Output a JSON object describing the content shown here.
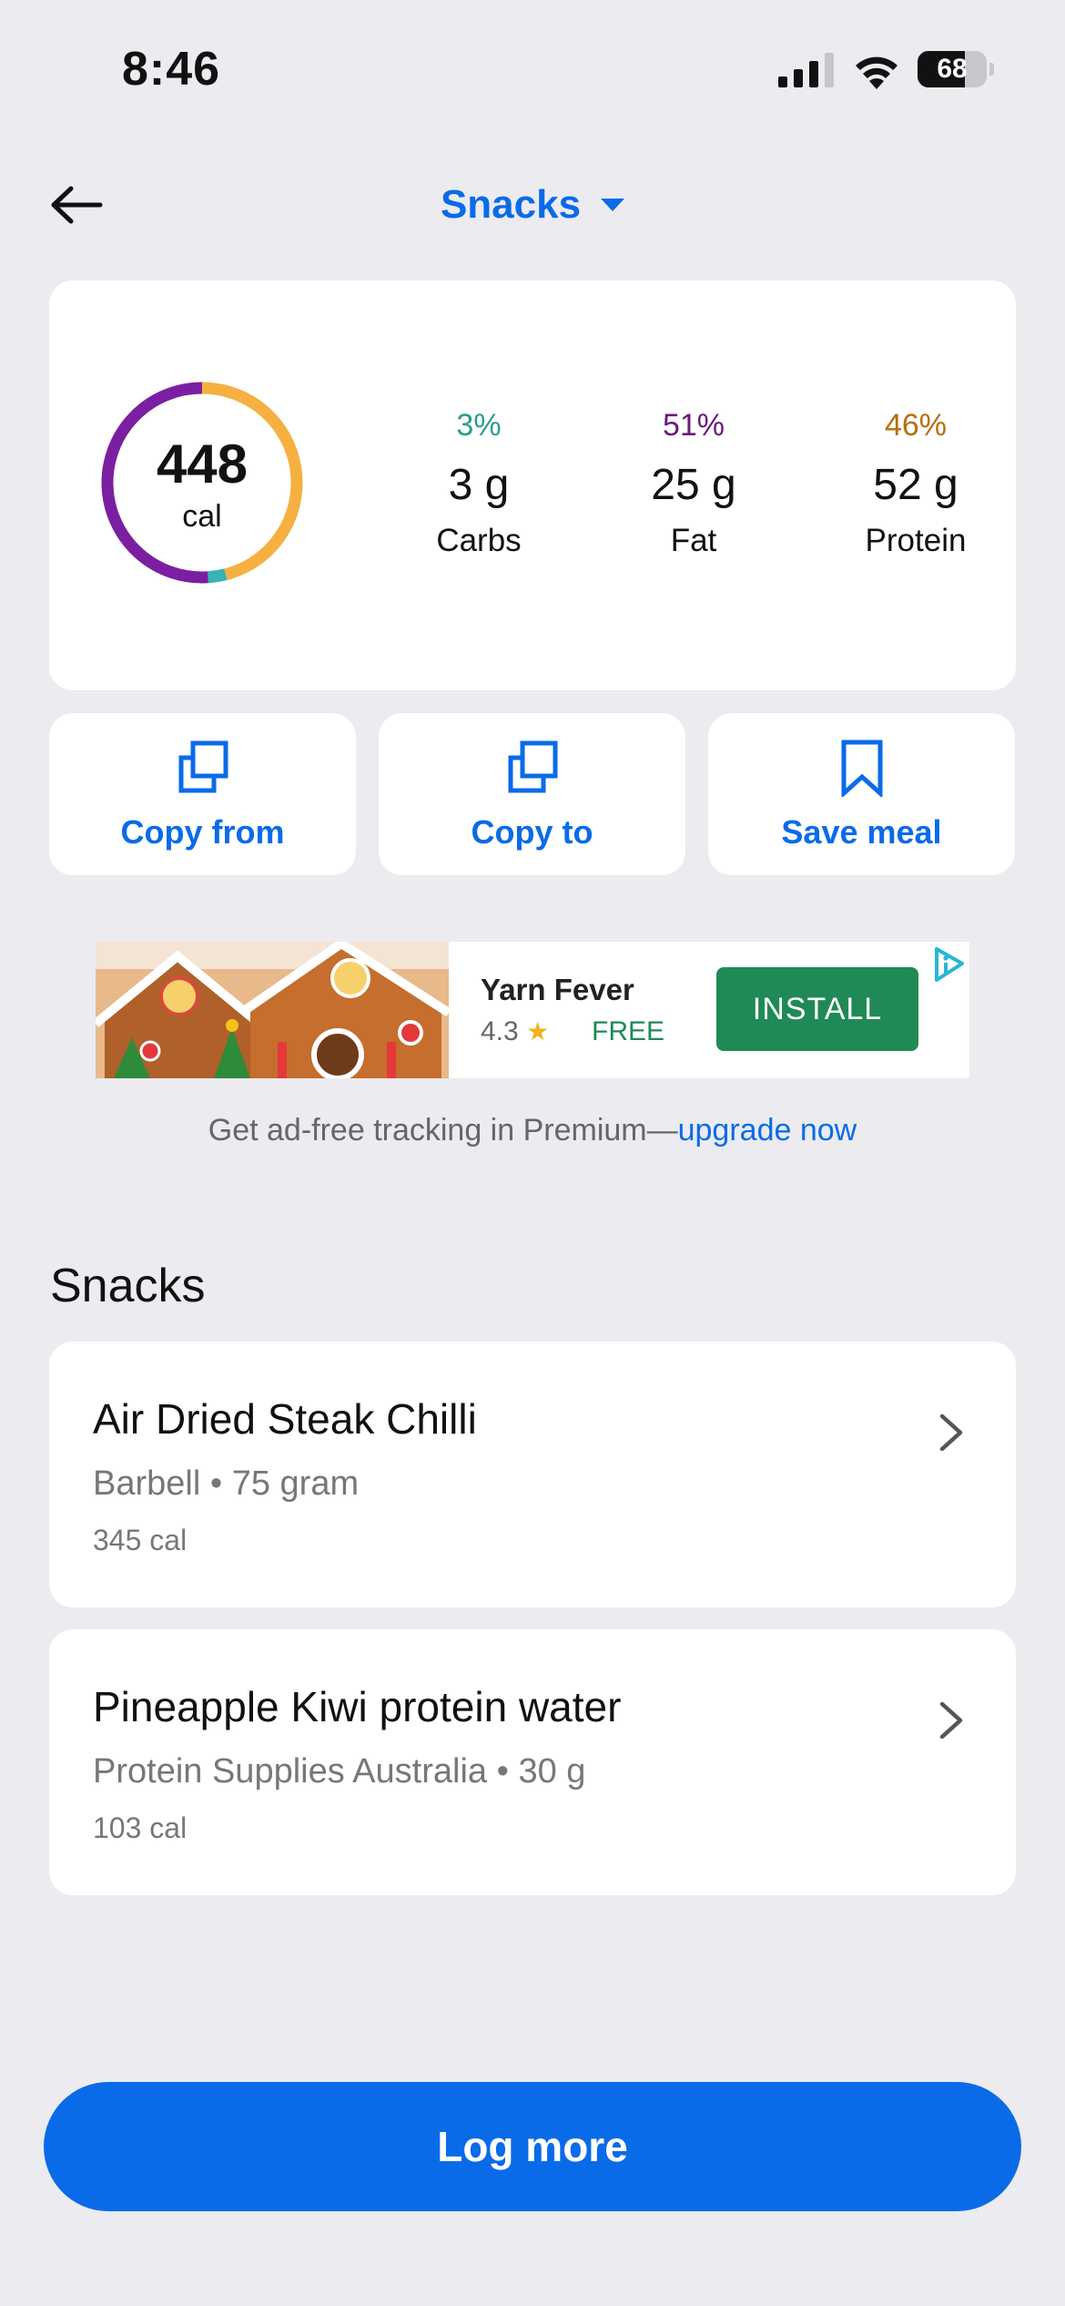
{
  "status_bar": {
    "time": "8:46",
    "battery": "68",
    "battery_level": 0.68
  },
  "nav": {
    "title": "Snacks"
  },
  "summary": {
    "calories": "448",
    "calories_unit": "cal",
    "macros": [
      {
        "percent": "3%",
        "amount": "3 g",
        "label": "Carbs",
        "color": "#2a9d8f",
        "ring_color": "#36b3b3",
        "share": 0.03
      },
      {
        "percent": "51%",
        "amount": "25 g",
        "label": "Fat",
        "color": "#6a1b7a",
        "ring_color": "#7b1fa2",
        "share": 0.51
      },
      {
        "percent": "46%",
        "amount": "52 g",
        "label": "Protein",
        "color": "#b86e0a",
        "ring_color": "#f5b041",
        "share": 0.46
      }
    ]
  },
  "actions": [
    {
      "label": "Copy from",
      "icon": "copy-icon"
    },
    {
      "label": "Copy to",
      "icon": "copy-icon"
    },
    {
      "label": "Save meal",
      "icon": "bookmark-icon"
    }
  ],
  "ad": {
    "app_name": "Yarn Fever",
    "rating": "4.3",
    "price": "FREE",
    "cta": "INSTALL"
  },
  "upgrade": {
    "text": "Get ad-free tracking in Premium—",
    "link": "upgrade now"
  },
  "section_title": "Snacks",
  "foods": [
    {
      "name": "Air Dried Steak Chilli",
      "brand": "Barbell",
      "serving": "75 gram",
      "calories": "345 cal"
    },
    {
      "name": "Pineapple Kiwi protein water",
      "brand": "Protein Supplies Australia",
      "serving": "30 g",
      "calories": "103 cal"
    }
  ],
  "log_more_label": "Log more",
  "colors": {
    "accent": "#0a6be8",
    "background": "#ebebf0",
    "install": "#1f8a55"
  }
}
